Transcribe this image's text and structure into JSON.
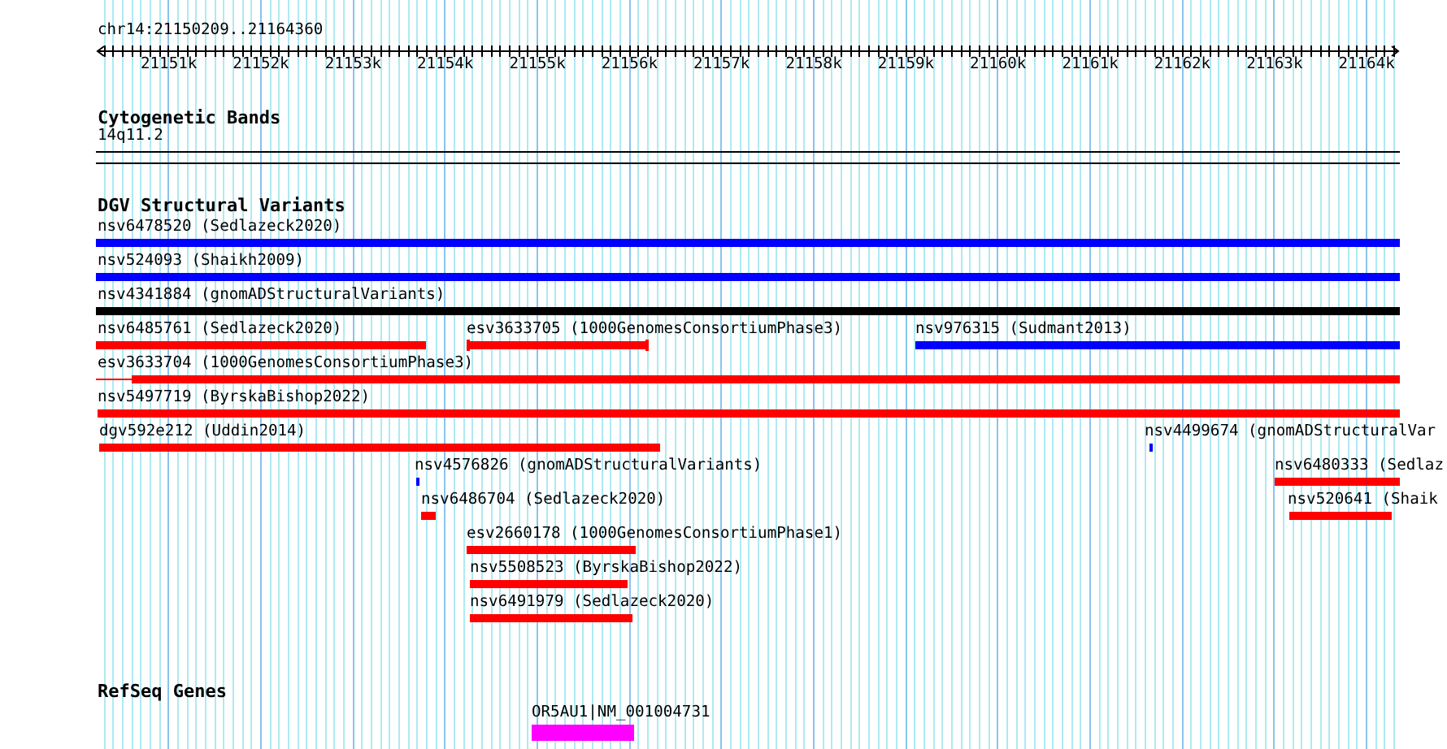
{
  "ruler": {
    "location": "chr14:21150209..21164360",
    "ticks": [
      "21151k",
      "21152k",
      "21153k",
      "21154k",
      "21155k",
      "21156k",
      "21157k",
      "21158k",
      "21159k",
      "21160k",
      "21161k",
      "21162k",
      "21163k",
      "21164k"
    ]
  },
  "tracks": [
    {
      "title": "Cytogenetic Bands",
      "kind": "bands",
      "features": [
        {
          "label": "14q11.2"
        }
      ]
    },
    {
      "title": "DGV Structural Variants",
      "kind": "variants",
      "features": [
        {
          "label": "nsv6478520 (Sedlazeck2020)",
          "color": "#0000ff"
        },
        {
          "label": "nsv524093 (Shaikh2009)",
          "color": "#0000ff"
        },
        {
          "label": "nsv4341884 (gnomADStructuralVariants)",
          "color": "#000000"
        },
        {
          "label": "nsv6485761 (Sedlazeck2020)",
          "color": "#ff0000"
        },
        {
          "label": "esv3633705 (1000GenomesConsortiumPhase3)",
          "color": "#ff0000"
        },
        {
          "label": "nsv976315 (Sudmant2013)",
          "color": "#0000ff"
        },
        {
          "label": "esv3633704 (1000GenomesConsortiumPhase3)",
          "color": "#ff0000"
        },
        {
          "label": "nsv5497719 (ByrskaBishop2022)",
          "color": "#ff0000"
        },
        {
          "label": "dgv592e212 (Uddin2014)",
          "color": "#ff0000"
        },
        {
          "label": "nsv4499674 (gnomADStructuralVar",
          "color": "#0000ff"
        },
        {
          "label": "nsv4576826 (gnomADStructuralVariants)",
          "color": "#0000ff"
        },
        {
          "label": "nsv6480333 (Sedlaz",
          "color": "#ff0000"
        },
        {
          "label": "nsv6486704 (Sedlazeck2020)",
          "color": "#ff0000"
        },
        {
          "label": "nsv520641 (Shaik",
          "color": "#ff0000"
        },
        {
          "label": "esv2660178 (1000GenomesConsortiumPhase1)",
          "color": "#ff0000"
        },
        {
          "label": "nsv5508523 (ByrskaBishop2022)",
          "color": "#ff0000"
        },
        {
          "label": "nsv6491979 (Sedlazeck2020)",
          "color": "#ff0000"
        }
      ]
    },
    {
      "title": "RefSeq Genes",
      "kind": "genes",
      "features": [
        {
          "label": "OR5AU1|NM_001004731",
          "color": "#ff00ff"
        }
      ]
    }
  ]
}
